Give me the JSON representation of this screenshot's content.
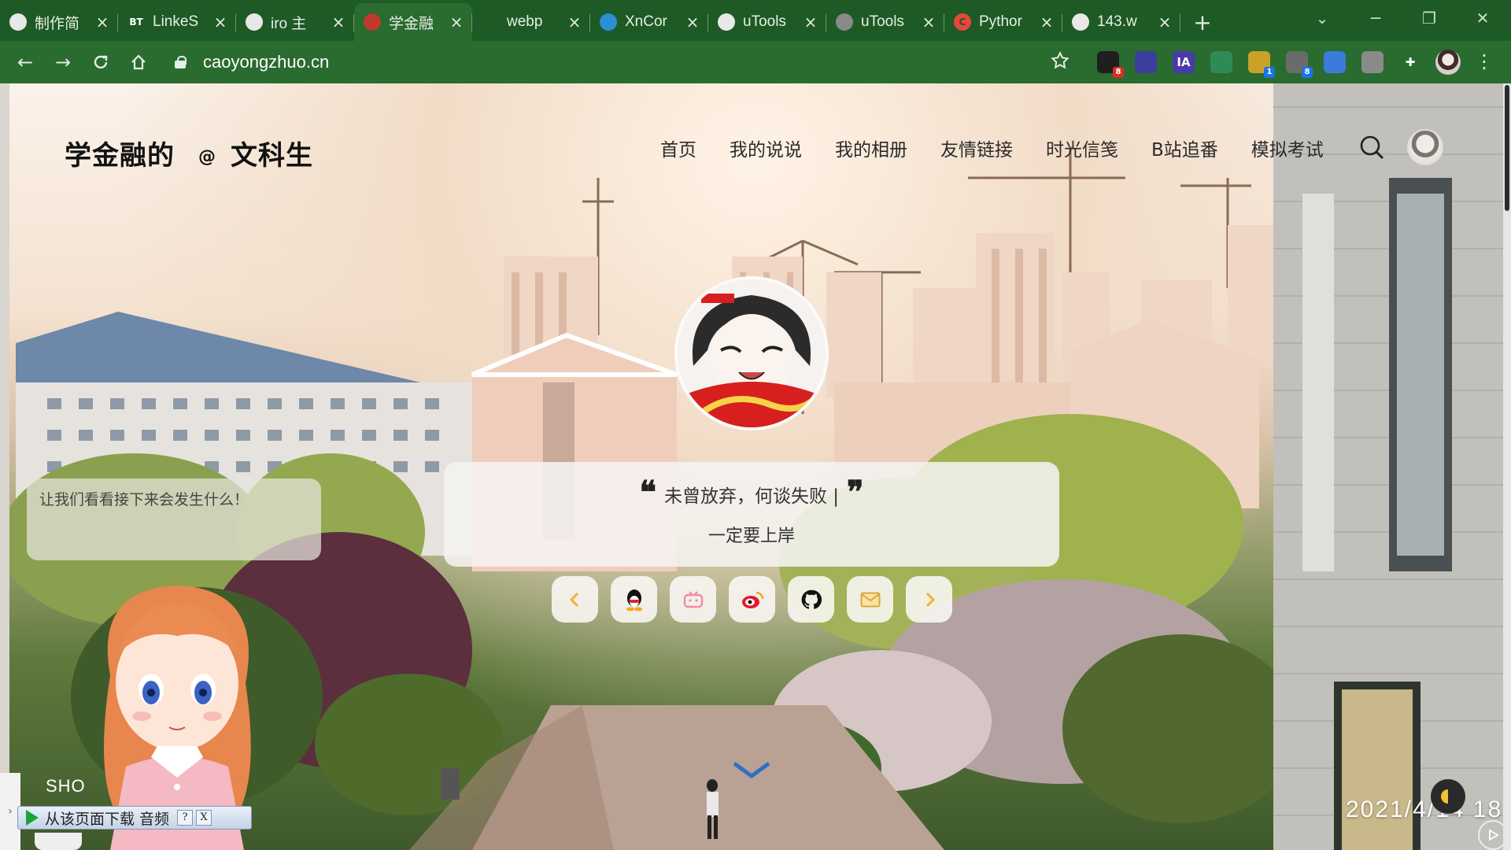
{
  "browser": {
    "tabs": [
      {
        "title": "制作简",
        "icon_name": "globe-icon",
        "active": false
      },
      {
        "title": "LinkeS",
        "icon_name": "bt-icon",
        "icon_text": "BT",
        "active": false
      },
      {
        "title": "iro 主",
        "icon_name": "wordpress-icon",
        "active": false
      },
      {
        "title": "学金融",
        "icon_name": "site-avatar-icon",
        "active": true
      },
      {
        "title": "webp",
        "icon_name": "pinwheel-icon",
        "active": false
      },
      {
        "title": "XnCor",
        "icon_name": "edge-icon",
        "active": false
      },
      {
        "title": "uTools",
        "icon_name": "globe-icon",
        "active": false
      },
      {
        "title": "uTools",
        "icon_name": "utools-icon",
        "active": false
      },
      {
        "title": "Pythor",
        "icon_name": "c-logo-icon",
        "icon_text": "C",
        "active": false
      },
      {
        "title": "143.w",
        "icon_name": "wordpress-icon",
        "active": false
      }
    ],
    "url": "caoyongzhuo.cn",
    "extensions": [
      {
        "name": "ext-1-icon",
        "badge": "8",
        "badge_color": "#d93025"
      },
      {
        "name": "ext-2-icon",
        "badge": ""
      },
      {
        "name": "ext-ia-icon",
        "text": "IA",
        "badge": ""
      },
      {
        "name": "ext-4-icon",
        "badge": ""
      },
      {
        "name": "ext-5-icon",
        "badge": "1",
        "badge_color": "#1a73e8"
      },
      {
        "name": "ext-6-icon",
        "badge": "8",
        "badge_color": "#1a73e8"
      },
      {
        "name": "translate-icon",
        "badge": ""
      },
      {
        "name": "ext-check-icon",
        "badge": ""
      },
      {
        "name": "puzzle-icon",
        "badge": ""
      }
    ]
  },
  "site": {
    "logo_left": "学金融的",
    "logo_at": "@",
    "logo_right": "文科生",
    "nav": [
      "首页",
      "我的说说",
      "我的相册",
      "友情链接",
      "时光信笺",
      "B站追番",
      "模拟考试"
    ],
    "quote_open": "❝",
    "quote_text": "未曾放弃，何谈失败 |",
    "quote_close": "❞",
    "quote_sub": "一定要上岸",
    "bubble_text": "让我们看看接下来会发生什么！",
    "clock": "2021/4/14 18",
    "shortcut_text": "SHO",
    "download_text": "从该页面下载 音频",
    "download_help": "?",
    "download_close": "X"
  },
  "colors": {
    "tab_bar": "#1e5a25",
    "toolbar": "#2a6b30"
  }
}
